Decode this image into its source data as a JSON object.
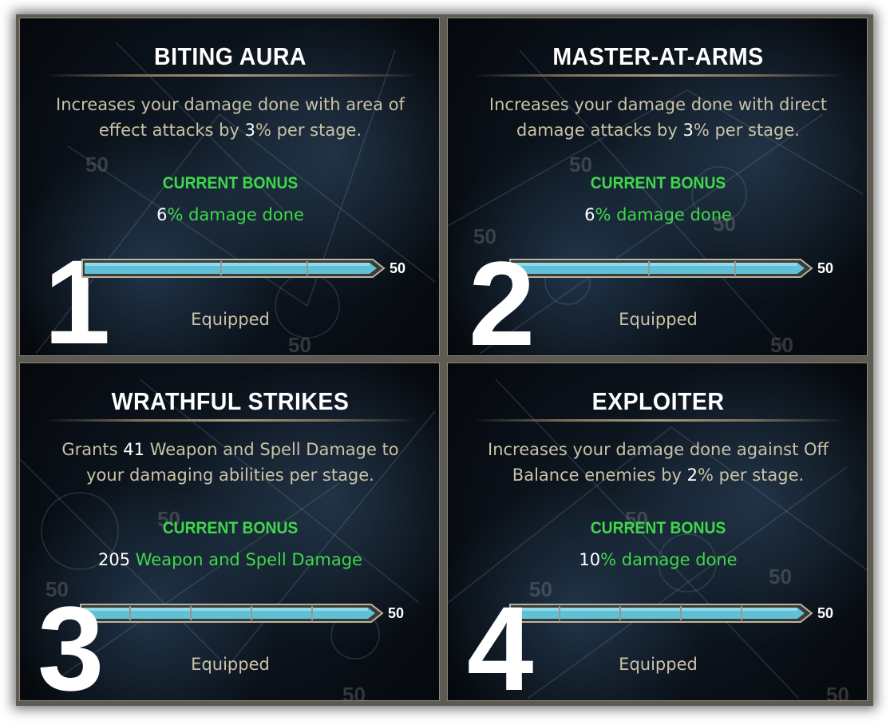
{
  "panels": [
    {
      "number": "1",
      "title": "BITING AURA",
      "desc_pre": "Increases your damage done with area of effect attacks by ",
      "desc_num": "3",
      "desc_post": "% per stage.",
      "bonus_label": "CURRENT BONUS",
      "bonus_num": "6",
      "bonus_text": "% damage done",
      "max_label": "50",
      "status": "Equipped",
      "progress": 1.0
    },
    {
      "number": "2",
      "title": "MASTER-AT-ARMS",
      "desc_pre": "Increases your damage done with direct damage attacks by ",
      "desc_num": "3",
      "desc_post": "% per stage.",
      "bonus_label": "CURRENT BONUS",
      "bonus_num": "6",
      "bonus_text": "% damage done",
      "max_label": "50",
      "status": "Equipped",
      "progress": 1.0
    },
    {
      "number": "3",
      "title": "WRATHFUL STRIKES",
      "desc_pre": "Grants ",
      "desc_num": "41",
      "desc_post": " Weapon and Spell Damage to your damaging abilities per stage.",
      "bonus_label": "CURRENT BONUS",
      "bonus_num": "205",
      "bonus_text": " Weapon and Spell Damage",
      "max_label": "50",
      "status": "Equipped",
      "progress": 1.0
    },
    {
      "number": "4",
      "title": "EXPLOITER",
      "desc_pre": "Increases your damage done against Off Balance enemies by ",
      "desc_num": "2",
      "desc_post": "% per stage.",
      "bonus_label": "CURRENT BONUS",
      "bonus_num": "10",
      "bonus_text": "% damage done",
      "max_label": "50",
      "status": "Equipped",
      "progress": 1.0
    }
  ],
  "background_marks": "50",
  "colors": {
    "bonus_green": "#3fd84a",
    "desc_text": "#c9c2a6",
    "bar_fill": "#5fc0d8",
    "title": "#ffffff"
  }
}
